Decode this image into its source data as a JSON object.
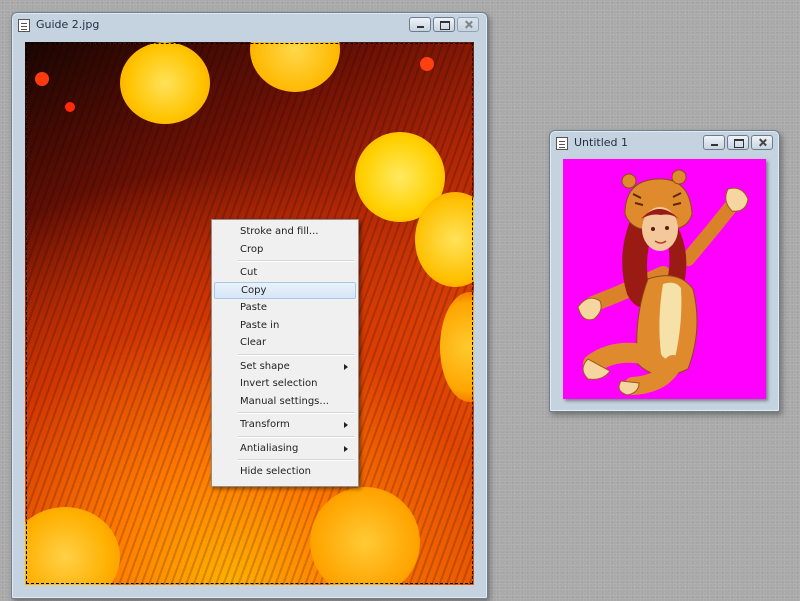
{
  "main_window": {
    "title": "Guide 2.jpg"
  },
  "second_window": {
    "title": "Untitled 1"
  },
  "context_menu": {
    "items": [
      {
        "label": "Stroke and fill...",
        "submenu": false
      },
      {
        "label": "Crop",
        "submenu": false
      },
      {
        "separator": true
      },
      {
        "label": "Cut",
        "submenu": false
      },
      {
        "label": "Copy",
        "submenu": false,
        "highlighted": true
      },
      {
        "label": "Paste",
        "submenu": false
      },
      {
        "label": "Paste in",
        "submenu": false
      },
      {
        "label": "Clear",
        "submenu": false
      },
      {
        "separator": true
      },
      {
        "label": "Set shape",
        "submenu": true
      },
      {
        "label": "Invert selection",
        "submenu": false
      },
      {
        "label": "Manual settings...",
        "submenu": false
      },
      {
        "separator": true
      },
      {
        "label": "Transform",
        "submenu": true
      },
      {
        "separator": true
      },
      {
        "label": "Antialiasing",
        "submenu": true
      },
      {
        "separator": true
      },
      {
        "label": "Hide selection",
        "submenu": false
      }
    ]
  },
  "colors": {
    "desktop": "#a9a9a9",
    "window_frame": "#c5d3e0",
    "menu_highlight": "#d6e6f7",
    "canvas_bg": "#ff00ff"
  },
  "icons": [
    "document-icon",
    "minimize-icon",
    "maximize-icon",
    "close-icon",
    "submenu-arrow-icon"
  ]
}
